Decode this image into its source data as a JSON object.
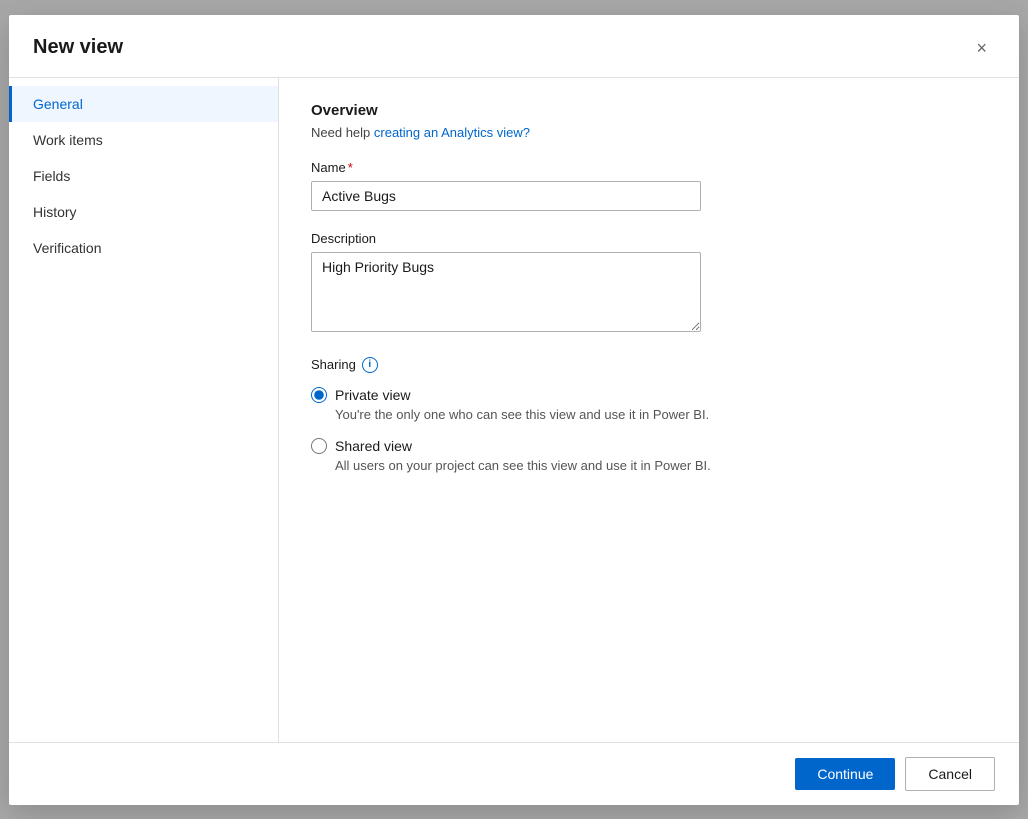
{
  "dialog": {
    "title": "New view",
    "close_label": "×"
  },
  "sidebar": {
    "items": [
      {
        "id": "general",
        "label": "General",
        "active": true
      },
      {
        "id": "work-items",
        "label": "Work items",
        "active": false
      },
      {
        "id": "fields",
        "label": "Fields",
        "active": false
      },
      {
        "id": "history",
        "label": "History",
        "active": false
      },
      {
        "id": "verification",
        "label": "Verification",
        "active": false
      }
    ]
  },
  "main": {
    "section_title": "Overview",
    "help_text_prefix": "Need help ",
    "help_link_text": "creating an Analytics view?",
    "name_label": "Name",
    "name_required": true,
    "name_value": "Active Bugs",
    "description_label": "Description",
    "description_value": "High Priority Bugs",
    "sharing_label": "Sharing",
    "info_icon_label": "i",
    "radio_options": [
      {
        "id": "private",
        "label": "Private view",
        "desc": "You're the only one who can see this view and use it in Power BI.",
        "checked": true
      },
      {
        "id": "shared",
        "label": "Shared view",
        "desc": "All users on your project can see this view and use it in Power BI.",
        "checked": false
      }
    ]
  },
  "footer": {
    "continue_label": "Continue",
    "cancel_label": "Cancel"
  }
}
